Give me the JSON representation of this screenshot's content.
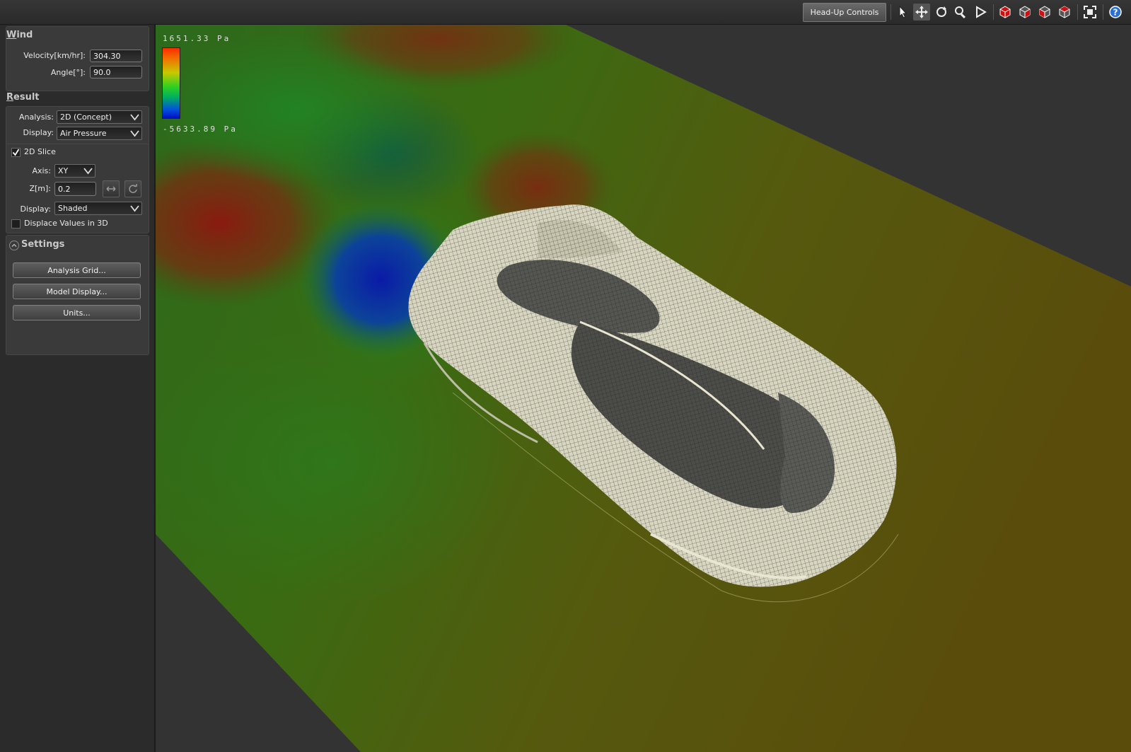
{
  "toolbar": {
    "hud_label": "Head-Up Controls",
    "icons": [
      "select-arrow-icon",
      "pan-icon",
      "orbit-icon",
      "zoom-icon",
      "play-icon",
      "red-cube-front-icon",
      "red-cube-side-icon",
      "red-cube-top-icon",
      "red-cube-iso-icon",
      "fit-view-icon",
      "help-icon"
    ]
  },
  "wind": {
    "title_first": "W",
    "title_rest": "ind",
    "velocity_label": "Velocity[km/hr]:",
    "velocity_value": "304.30",
    "angle_label": "Angle[°]:",
    "angle_value": "90.0"
  },
  "result": {
    "title_first": "R",
    "title_rest": "esult",
    "analysis_label": "Analysis:",
    "analysis_value": "2D (Concept)",
    "display_label": "Display:",
    "display_value": "Air Pressure",
    "slice_label": "2D Slice",
    "slice_checked": true,
    "axis_label": "Axis:",
    "axis_value": "XY",
    "z_label": "Z[m]:",
    "z_value": "0.2",
    "display2_label": "Display:",
    "display2_value": "Shaded",
    "displace_label": "Displace Values in 3D",
    "displace_checked": false
  },
  "settings": {
    "title": "Settings",
    "buttons": [
      "Analysis Grid...",
      "Model Display...",
      "Units..."
    ]
  },
  "legend": {
    "max": "1651.33 Pa",
    "min": "-5633.89 Pa",
    "colors": [
      "#ff2a00",
      "#c8c800",
      "#30d020",
      "#0050e0"
    ]
  }
}
